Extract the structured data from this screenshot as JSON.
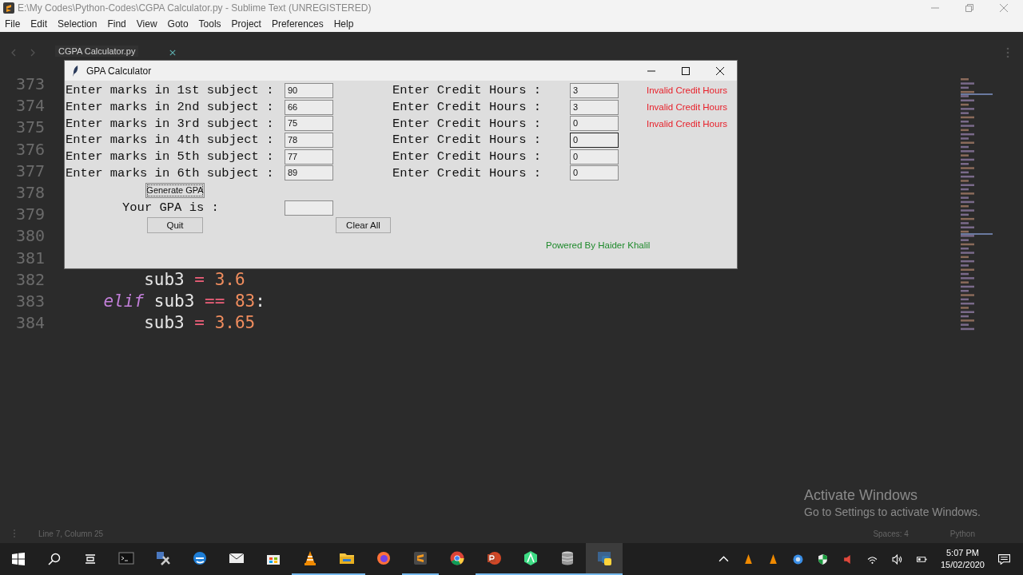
{
  "window": {
    "title": "E:\\My Codes\\Python-Codes\\CGPA Calculator.py - Sublime Text (UNREGISTERED)"
  },
  "menu": [
    "File",
    "Edit",
    "Selection",
    "Find",
    "View",
    "Goto",
    "Tools",
    "Project",
    "Preferences",
    "Help"
  ],
  "tabs": [
    {
      "label": "CGPA Calculator.py",
      "selected": true
    }
  ],
  "editor": {
    "lines": [
      {
        "number": "373"
      },
      {
        "number": "374"
      },
      {
        "number": "375"
      },
      {
        "number": "376"
      },
      {
        "number": "377"
      },
      {
        "number": "378"
      },
      {
        "number": "379"
      },
      {
        "number": "380"
      },
      {
        "number": "381"
      },
      {
        "number": "382",
        "tokens": [
          {
            "kind": "name",
            "text": "        sub3"
          },
          {
            "kind": "operator",
            "text": " = "
          },
          {
            "kind": "number",
            "text": "3.6"
          }
        ]
      },
      {
        "number": "383",
        "tokens": [
          {
            "kind": "keyword",
            "text": "    elif"
          },
          {
            "kind": "name",
            "text": " sub3"
          },
          {
            "kind": "operator",
            "text": " == "
          },
          {
            "kind": "number",
            "text": "83"
          },
          {
            "kind": "name",
            "text": ":"
          }
        ]
      },
      {
        "number": "384",
        "tokens": [
          {
            "kind": "name",
            "text": "        sub3"
          },
          {
            "kind": "operator",
            "text": " = "
          },
          {
            "kind": "number",
            "text": "3.65"
          }
        ]
      }
    ]
  },
  "status_bar": {
    "position": "Line 7, Column 25",
    "indentation": "Spaces: 4",
    "syntax": "Python"
  },
  "dialog": {
    "title": "GPA Calculator",
    "subjects": [
      {
        "label": "Enter marks in 1st subject :",
        "marks": "90",
        "credit_label": "Enter Credit Hours :",
        "credit": "3",
        "focused": false,
        "error": "Invalid Credit Hours"
      },
      {
        "label": "Enter marks in 2nd subject :",
        "marks": "66",
        "credit_label": "Enter Credit Hours :",
        "credit": "3",
        "focused": false,
        "error": "Invalid Credit Hours"
      },
      {
        "label": "Enter marks in 3rd subject :",
        "marks": "75",
        "credit_label": "Enter Credit Hours :",
        "credit": "0",
        "focused": false,
        "error": "Invalid Credit Hours"
      },
      {
        "label": "Enter marks in 4th subject :",
        "marks": "78",
        "credit_label": "Enter Credit Hours :",
        "credit": "0",
        "focused": true
      },
      {
        "label": "Enter marks in 5th subject :",
        "marks": "77",
        "credit_label": "Enter Credit Hours :",
        "credit": "0",
        "focused": false
      },
      {
        "label": "Enter marks in 6th subject :",
        "marks": "89",
        "credit_label": "Enter Credit Hours :",
        "credit": "0",
        "focused": false
      }
    ],
    "generate_button": "Generate GPA",
    "gpa_label": "Your GPA is :",
    "quit_button": "Quit",
    "clear_button": "Clear All",
    "credit": "Powered By Haider Khalil"
  },
  "activation": {
    "title": "Activate Windows",
    "message": "Go to Settings to activate Windows."
  },
  "taskbar": {
    "apps": [
      {
        "kind": "terminal",
        "running": false,
        "selected": false
      },
      {
        "kind": "tools",
        "running": false,
        "selected": false
      },
      {
        "kind": "edge",
        "running": false,
        "selected": false
      },
      {
        "kind": "mail",
        "running": false,
        "selected": false
      },
      {
        "kind": "store",
        "running": false,
        "selected": false
      },
      {
        "kind": "vlc",
        "running": true,
        "selected": false
      },
      {
        "kind": "folder",
        "running": true,
        "selected": false
      },
      {
        "kind": "firefox",
        "running": false,
        "selected": false
      },
      {
        "kind": "sublime",
        "running": true,
        "selected": false
      },
      {
        "kind": "chrome",
        "running": false,
        "selected": false
      },
      {
        "kind": "powerpoint",
        "running": true,
        "selected": false
      },
      {
        "kind": "android",
        "running": true,
        "selected": false
      },
      {
        "kind": "database",
        "running": true,
        "selected": false
      },
      {
        "kind": "python",
        "running": true,
        "selected": true
      }
    ],
    "time": "5:07 PM",
    "date": "15/02/2020"
  }
}
